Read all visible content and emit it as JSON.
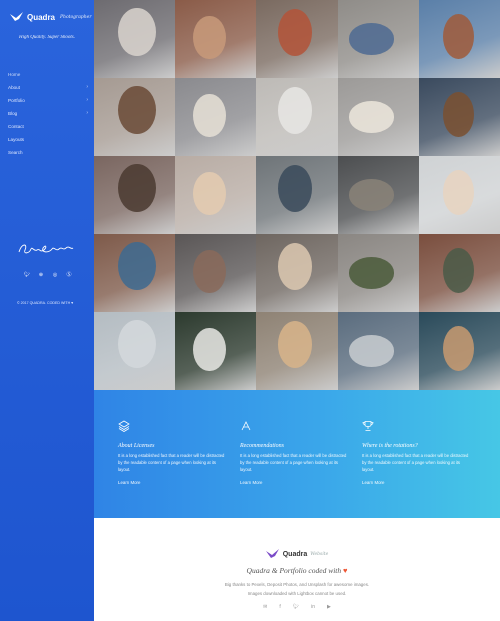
{
  "brand": {
    "name": "Quadra",
    "subtitle": "Photographer",
    "tagline": "High Quality. Super Shoots."
  },
  "menu": {
    "items": [
      {
        "label": "Home",
        "has_children": false,
        "active": true
      },
      {
        "label": "About",
        "has_children": true,
        "active": false
      },
      {
        "label": "Portfolio",
        "has_children": true,
        "active": false
      },
      {
        "label": "Blog",
        "has_children": true,
        "active": false
      },
      {
        "label": "Contact",
        "has_children": false,
        "active": false
      },
      {
        "label": "Layouts",
        "has_children": false,
        "active": false
      },
      {
        "label": "Search",
        "has_children": false,
        "active": false
      }
    ]
  },
  "signature": {
    "text": "Quadra Gold Type"
  },
  "social_icons": [
    "twitter-icon",
    "pinterest-icon",
    "dribbble-icon",
    "skype-icon"
  ],
  "copyright": "© 2017 QUADRA. CODED WITH",
  "features": [
    {
      "icon": "layers-icon",
      "title": "About Licenses",
      "body": "It is a long established fact that a reader will be distracted by the readable content of a page when looking at its layout.",
      "link": "Learn More"
    },
    {
      "icon": "compass-icon",
      "title": "Recommendations",
      "body": "It is a long established fact that a reader will be distracted by the readable content of a page when looking at its layout.",
      "link": "Learn More"
    },
    {
      "icon": "trophy-icon",
      "title": "Where is the rotations?",
      "body": "It is a long established fact that a reader will be distracted by the readable content of a page when looking at its layout.",
      "link": "Learn More"
    }
  ],
  "footer": {
    "brand": "Quadra",
    "brand_sub": "Website",
    "coded": "Quadra & Portfolio coded with",
    "thanks_line1": "Big thanks to Pexels, Deposit Photos, and Unsplash for awesome images.",
    "thanks_line2": "Images downloaded with Lightbox cannot be used.",
    "social_icons": [
      "mail-icon",
      "facebook-icon",
      "twitter-icon",
      "linkedin-icon",
      "youtube-icon"
    ]
  },
  "colors": {
    "sidebar": "#2160d8",
    "accent": "#3aa6ea",
    "heart": "#e53333"
  },
  "gallery": [
    {
      "name": "photo-blonde-woman",
      "bg": "#6d6b70",
      "fig": "#d9d3ce"
    },
    {
      "name": "photo-woman-coffee",
      "bg": "#8a5b48",
      "fig": "#c89a7a"
    },
    {
      "name": "photo-red-hair-woman",
      "bg": "#7a6a60",
      "fig": "#b35438"
    },
    {
      "name": "photo-jeans-legs",
      "bg": "#8f8c88",
      "fig": "#4e6a92"
    },
    {
      "name": "photo-backpack-tree",
      "bg": "#5a7fa8",
      "fig": "#a05a3a"
    },
    {
      "name": "photo-bag-on-floor",
      "bg": "#a59a92",
      "fig": "#6a4a36"
    },
    {
      "name": "photo-hair-blowing",
      "bg": "#8a8a8e",
      "fig": "#e6e0d6"
    },
    {
      "name": "photo-dancer",
      "bg": "#bdbab6",
      "fig": "#e8e6e4"
    },
    {
      "name": "photo-blonde-lean",
      "bg": "#9c9a98",
      "fig": "#ece6dc"
    },
    {
      "name": "photo-camera-hands",
      "bg": "#3a4a5e",
      "fig": "#7a5030"
    },
    {
      "name": "photo-bag-items",
      "bg": "#7a6660",
      "fig": "#4a3a30"
    },
    {
      "name": "photo-woman-portrait",
      "bg": "#b8aca4",
      "fig": "#e4cbb0"
    },
    {
      "name": "photo-sneakers",
      "bg": "#6e7478",
      "fig": "#3a4a5a"
    },
    {
      "name": "photo-hat-on-rock",
      "bg": "#4c4e50",
      "fig": "#8a8278"
    },
    {
      "name": "photo-woman-window",
      "bg": "#cfd2d4",
      "fig": "#e8d4c0"
    },
    {
      "name": "photo-couple-selfie",
      "bg": "#7e5a4a",
      "fig": "#3d6a90"
    },
    {
      "name": "photo-friends-group",
      "bg": "#5a5656",
      "fig": "#8a6a5a"
    },
    {
      "name": "photo-laptop-couple",
      "bg": "#6e6660",
      "fig": "#dcc8b0"
    },
    {
      "name": "photo-man-jacket",
      "bg": "#8a8682",
      "fig": "#4a5a3a"
    },
    {
      "name": "photo-couple-reading",
      "bg": "#7a4e3e",
      "fig": "#4a5a48"
    },
    {
      "name": "photo-legs-popcorn",
      "bg": "#b4bcc2",
      "fig": "#d4d8dc"
    },
    {
      "name": "photo-coffee-cup",
      "bg": "#2c3a2e",
      "fig": "#e8e8e4"
    },
    {
      "name": "photo-camera-man",
      "bg": "#8e8274",
      "fig": "#d8b48a"
    },
    {
      "name": "photo-grey-hair",
      "bg": "#5a6c7e",
      "fig": "#c8ccd0"
    },
    {
      "name": "photo-sitting-couple",
      "bg": "#2a4a5a",
      "fig": "#c89a70"
    }
  ]
}
